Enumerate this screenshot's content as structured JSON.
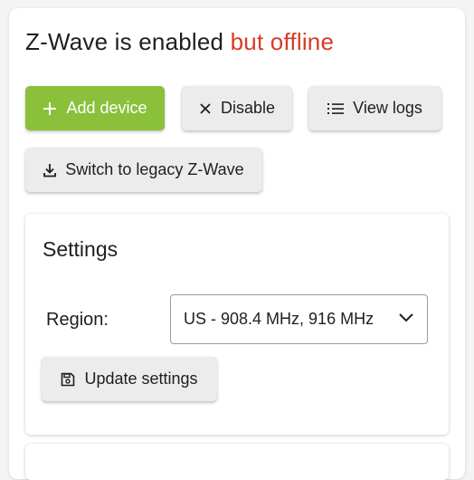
{
  "header": {
    "title_prefix": "Z-Wave is enabled",
    "title_status": "but offline",
    "status_color": "#d63b24"
  },
  "actions": {
    "add_device": {
      "label": "Add device",
      "icon": "plus-icon",
      "color": "#8bc03a"
    },
    "disable": {
      "label": "Disable",
      "icon": "close-icon"
    },
    "view_logs": {
      "label": "View logs",
      "icon": "list-icon"
    },
    "switch_legacy": {
      "label": "Switch to legacy Z-Wave",
      "icon": "download-icon"
    }
  },
  "settings": {
    "title": "Settings",
    "region_label": "Region:",
    "region_value": "US - 908.4 MHz, 916 MHz",
    "update_button": {
      "label": "Update settings",
      "icon": "save-icon"
    }
  }
}
